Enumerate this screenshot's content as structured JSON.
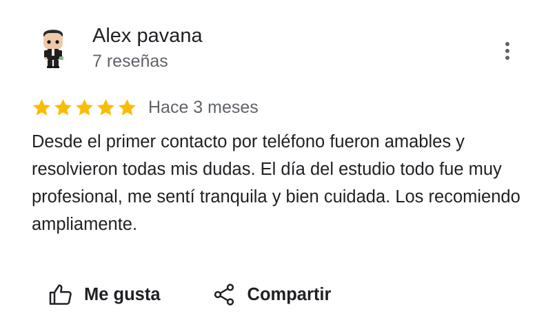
{
  "review": {
    "author_name": "Alex pavana",
    "author_reviews": "7 reseñas",
    "rating": 5,
    "rating_max": 5,
    "time_ago": "Hace 3 meses",
    "text": "Desde el primer contacto por teléfono fueron amables y resolvieron todas mis dudas. El día del estudio todo fue muy profesional, me sentí tranquila y bien cuidada. Los recomiendo ampliamente."
  },
  "actions": {
    "like_label": "Me gusta",
    "share_label": "Compartir"
  },
  "icons": {
    "avatar": "funko-figure-avatar",
    "more": "more-vert-icon",
    "star": "star-icon",
    "like": "thumb-up-icon",
    "share": "share-icon"
  },
  "colors": {
    "star": "#fbbc04",
    "text_primary": "#202124",
    "text_secondary": "#5f6368"
  }
}
